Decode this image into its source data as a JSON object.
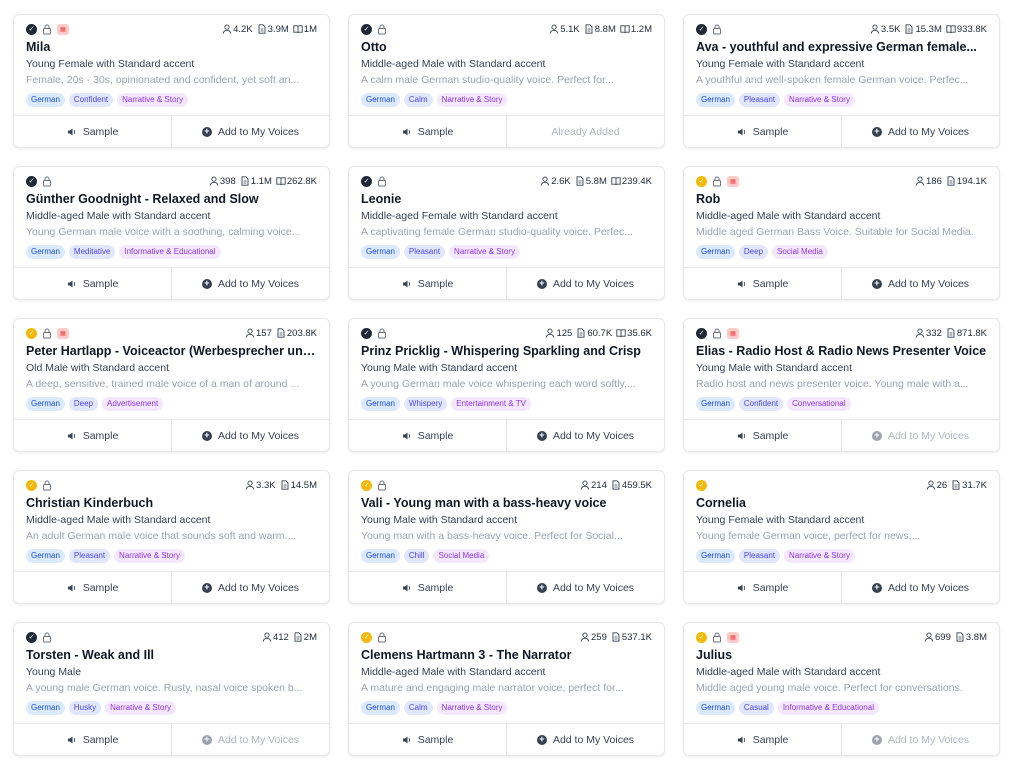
{
  "actions": {
    "sample_label": "Sample",
    "add_label": "Add to My Voices",
    "already_added_label": "Already Added"
  },
  "cards": [
    {
      "name": "Mila",
      "subtitle": "Young Female with Standard accent",
      "description": "Female, 20s - 30s, opinionated and confident, yet soft an...",
      "badge": "verified",
      "hq": true,
      "stats": {
        "users": "4.2K",
        "chars": "3.9M",
        "book": "1M"
      },
      "tags": [
        {
          "label": "German",
          "kind": "lang"
        },
        {
          "label": "Confident",
          "kind": "style"
        },
        {
          "label": "Narrative & Story",
          "kind": "use"
        }
      ],
      "added": false,
      "add_muted": false
    },
    {
      "name": "Otto",
      "subtitle": "Middle-aged Male with Standard accent",
      "description": "A calm male German studio-quality voice. Perfect for...",
      "badge": "verified",
      "hq": false,
      "stats": {
        "users": "5.1K",
        "chars": "8.8M",
        "book": "1.2M"
      },
      "tags": [
        {
          "label": "German",
          "kind": "lang"
        },
        {
          "label": "Calm",
          "kind": "style"
        },
        {
          "label": "Narrative & Story",
          "kind": "use"
        }
      ],
      "added": true,
      "add_muted": false
    },
    {
      "name": "Ava - youthful and expressive German female...",
      "subtitle": "Young Female with Standard accent",
      "description": "A youthful and well-spoken female German voice. Perfec...",
      "badge": "verified",
      "hq": false,
      "stats": {
        "users": "3.5K",
        "chars": "15.3M",
        "book": "933.8K"
      },
      "tags": [
        {
          "label": "German",
          "kind": "lang"
        },
        {
          "label": "Pleasant",
          "kind": "style"
        },
        {
          "label": "Narrative & Story",
          "kind": "use"
        }
      ],
      "added": false,
      "add_muted": false
    },
    {
      "name": "Günther Goodnight - Relaxed and Slow",
      "subtitle": "Middle-aged Male with Standard accent",
      "description": "Young German male voice with a soothing, calming voice...",
      "badge": "verified",
      "hq": false,
      "stats": {
        "users": "398",
        "chars": "1.1M",
        "book": "262.8K"
      },
      "tags": [
        {
          "label": "German",
          "kind": "lang"
        },
        {
          "label": "Meditative",
          "kind": "style"
        },
        {
          "label": "Informative & Educational",
          "kind": "use"
        }
      ],
      "added": false,
      "add_muted": false
    },
    {
      "name": "Leonie",
      "subtitle": "Middle-aged Female with Standard accent",
      "description": "A captivating female German studio-quality voice. Perfec...",
      "badge": "verified",
      "hq": false,
      "stats": {
        "users": "2.6K",
        "chars": "5.8M",
        "book": "239.4K"
      },
      "tags": [
        {
          "label": "German",
          "kind": "lang"
        },
        {
          "label": "Pleasant",
          "kind": "style"
        },
        {
          "label": "Narrative & Story",
          "kind": "use"
        }
      ],
      "added": false,
      "add_muted": false
    },
    {
      "name": "Rob",
      "subtitle": "Middle-aged Male with Standard accent",
      "description": "Middle aged German Bass Voice. Suitable for Social Media.",
      "badge": "gold",
      "hq": true,
      "stats": {
        "users": "186",
        "chars": "194.1K",
        "book": ""
      },
      "tags": [
        {
          "label": "German",
          "kind": "lang"
        },
        {
          "label": "Deep",
          "kind": "style"
        },
        {
          "label": "Social Media",
          "kind": "use"
        }
      ],
      "added": false,
      "add_muted": false
    },
    {
      "name": "Peter Hartlapp - Voiceactor (Werbesprecher und...",
      "subtitle": "Old Male with Standard accent",
      "description": "A deep, sensitive, trained male voice of a man of around ...",
      "badge": "gold",
      "hq": true,
      "stats": {
        "users": "157",
        "chars": "203.8K",
        "book": ""
      },
      "tags": [
        {
          "label": "German",
          "kind": "lang"
        },
        {
          "label": "Deep",
          "kind": "style"
        },
        {
          "label": "Advertisement",
          "kind": "use"
        }
      ],
      "added": false,
      "add_muted": false
    },
    {
      "name": "Prinz Pricklig - Whispering Sparkling and Crisp",
      "subtitle": "Young Male with Standard accent",
      "description": "A young German male voice whispering each word softly,...",
      "badge": "verified",
      "hq": false,
      "stats": {
        "users": "125",
        "chars": "60.7K",
        "book": "35.6K"
      },
      "tags": [
        {
          "label": "German",
          "kind": "lang"
        },
        {
          "label": "Whispery",
          "kind": "style"
        },
        {
          "label": "Entertainment & TV",
          "kind": "use"
        }
      ],
      "added": false,
      "add_muted": false
    },
    {
      "name": "Elias - Radio Host & Radio News Presenter Voice",
      "subtitle": "Young Male with Standard accent",
      "description": "Radio host and news presenter voice. Young male with a...",
      "badge": "verified",
      "hq": true,
      "stats": {
        "users": "332",
        "chars": "871.8K",
        "book": ""
      },
      "tags": [
        {
          "label": "German",
          "kind": "lang"
        },
        {
          "label": "Confident",
          "kind": "style"
        },
        {
          "label": "Conversational",
          "kind": "use"
        }
      ],
      "added": false,
      "add_muted": true
    },
    {
      "name": "Christian Kinderbuch",
      "subtitle": "Middle-aged Male with Standard accent",
      "description": "An adult German male voice that sounds soft and warm....",
      "badge": "gold",
      "hq": false,
      "stats": {
        "users": "3.3K",
        "chars": "14.5M",
        "book": ""
      },
      "tags": [
        {
          "label": "German",
          "kind": "lang"
        },
        {
          "label": "Pleasant",
          "kind": "style"
        },
        {
          "label": "Narrative & Story",
          "kind": "use"
        }
      ],
      "added": false,
      "add_muted": false
    },
    {
      "name": "Vali - Young man with a bass-heavy voice",
      "subtitle": "Young Male with Standard accent",
      "description": "Young man with a bass-heavy voice. Perfect for Social...",
      "badge": "gold",
      "hq": false,
      "stats": {
        "users": "214",
        "chars": "459.5K",
        "book": ""
      },
      "tags": [
        {
          "label": "German",
          "kind": "lang"
        },
        {
          "label": "Chill",
          "kind": "style"
        },
        {
          "label": "Social Media",
          "kind": "use"
        }
      ],
      "added": false,
      "add_muted": false
    },
    {
      "name": "Cornelia",
      "subtitle": "Young Female with Standard accent",
      "description": "Young female German voice, perfect for news,...",
      "badge": "gold",
      "hq": false,
      "lock": false,
      "stats": {
        "users": "26",
        "chars": "31.7K",
        "book": ""
      },
      "tags": [
        {
          "label": "German",
          "kind": "lang"
        },
        {
          "label": "Pleasant",
          "kind": "style"
        },
        {
          "label": "Narrative & Story",
          "kind": "use"
        }
      ],
      "added": false,
      "add_muted": false
    },
    {
      "name": "Torsten - Weak and Ill",
      "subtitle": "Young Male",
      "description": "A young male German voice. Rusty, nasal voice spoken b...",
      "badge": "verified",
      "hq": false,
      "stats": {
        "users": "412",
        "chars": "2M",
        "book": ""
      },
      "tags": [
        {
          "label": "German",
          "kind": "lang"
        },
        {
          "label": "Husky",
          "kind": "style"
        },
        {
          "label": "Narrative & Story",
          "kind": "use"
        }
      ],
      "added": false,
      "add_muted": true
    },
    {
      "name": "Clemens Hartmann 3 - The Narrator",
      "subtitle": "Middle-aged Male with Standard accent",
      "description": "A mature and engaging male narrator voice, perfect for...",
      "badge": "gold",
      "hq": false,
      "stats": {
        "users": "259",
        "chars": "537.1K",
        "book": ""
      },
      "tags": [
        {
          "label": "German",
          "kind": "lang"
        },
        {
          "label": "Calm",
          "kind": "style"
        },
        {
          "label": "Narrative & Story",
          "kind": "use"
        }
      ],
      "added": false,
      "add_muted": false
    },
    {
      "name": "Julius",
      "subtitle": "Middle-aged Male with Standard accent",
      "description": "Middle aged young male voice. Perfect for conversations.",
      "badge": "gold",
      "hq": true,
      "stats": {
        "users": "699",
        "chars": "3.8M",
        "book": ""
      },
      "tags": [
        {
          "label": "German",
          "kind": "lang"
        },
        {
          "label": "Casual",
          "kind": "style"
        },
        {
          "label": "Informative & Educational",
          "kind": "use"
        }
      ],
      "added": false,
      "add_muted": true
    }
  ]
}
